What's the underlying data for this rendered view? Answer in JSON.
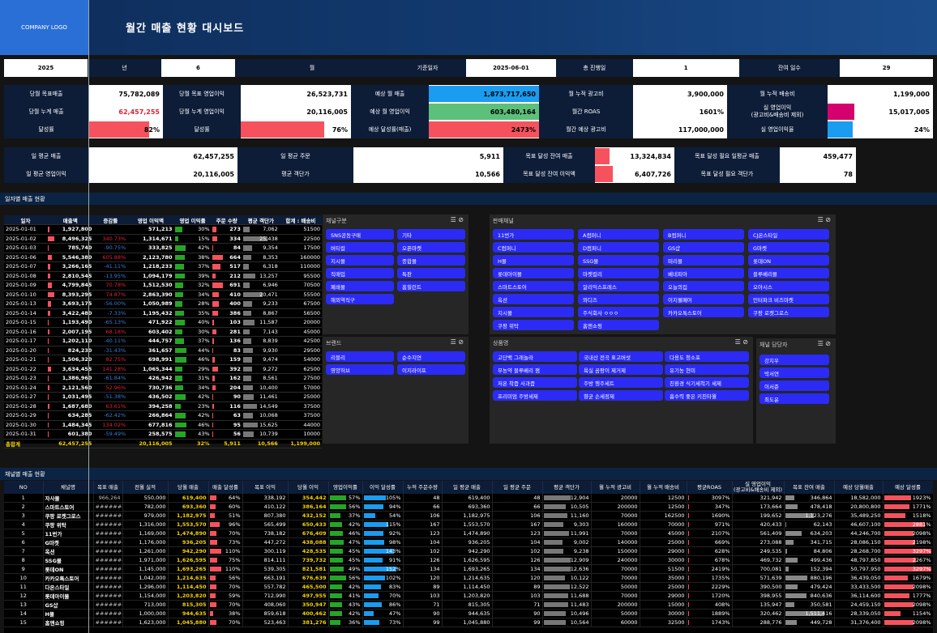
{
  "header": {
    "logo": "COMPANY LOGO",
    "title": "월간 매출 현황 대시보드"
  },
  "filters": {
    "year": "2025",
    "year_label": "년",
    "month": "6",
    "month_label": "월",
    "base_label": "기준일자",
    "base_date": "2025-06-01",
    "elapsed_label": "총 진행일",
    "elapsed": "1",
    "remain_label": "잔여 일수",
    "remain": "29"
  },
  "kpi": [
    {
      "label": "당월 목표매출",
      "value": "75,782,089"
    },
    {
      "label": "당월 목표 영업이익",
      "value": "26,523,731"
    },
    {
      "label": "예상 월 매출",
      "value": "1,873,717,650",
      "bar": 1.0,
      "color": "#1a9cf0"
    },
    {
      "label": "월 누적 광고비",
      "value": "3,900,000"
    },
    {
      "label": "월 누적 배송비",
      "value": "1,199,000"
    },
    {
      "label": "당월 누계 매출",
      "value": "62,457,255",
      "red": true
    },
    {
      "label": "당월 누계 영업이익",
      "value": "20,116,005"
    },
    {
      "label": "예상 월 영업이익",
      "value": "603,480,164",
      "bar": 1.0,
      "color": "#5cc07a"
    },
    {
      "label": "월간 ROAS",
      "value": "1601%"
    },
    {
      "label": "실 영업이익\n(광고비&배송비 제외)",
      "value": "15,017,005",
      "bar": 0.25,
      "color": "#d4006e"
    },
    {
      "label": "달성률",
      "value": "82%",
      "bar": 0.82,
      "color": "#f6525e"
    },
    {
      "label": "달성률",
      "value": "76%",
      "bar": 0.76,
      "color": "#f6525e"
    },
    {
      "label": "예상 달성률(매출)",
      "value": "2473%",
      "bar": 1.0,
      "color": "#f6525e"
    },
    {
      "label": "월간 예상 광고비",
      "value": "117,000,000"
    },
    {
      "label": "실 영업이익율",
      "value": "24%",
      "bar": 0.24,
      "color": "#1a9cf0"
    }
  ],
  "kpi2": [
    {
      "label": "일 평균 매출",
      "value": "62,457,255"
    },
    {
      "label": "일 평균 주문",
      "value": "5,911"
    },
    {
      "label": "목표 달성 잔여 매출",
      "value": "13,324,834",
      "bar": 0.18,
      "color": "#f6525e"
    },
    {
      "label": "목표 달성 필요 일평균 매출",
      "value": "459,477"
    },
    {
      "label": "일 평균 영업이익",
      "value": "20,116,005"
    },
    {
      "label": "평균 객단가",
      "value": "10,566"
    },
    {
      "label": "목표 달성 잔여 이익액",
      "value": "6,407,726",
      "bar": 0.22,
      "color": "#f6525e"
    },
    {
      "label": "목표 달성 필요 객단가",
      "value": "78"
    }
  ],
  "daily_section": "일자별 매출 현황",
  "daily_headers": [
    "일자",
    "매출액",
    "증감률",
    "영업 이익액",
    "영업 이익률",
    "주문 수량",
    "평균 객단가",
    "합계 : 배송비"
  ],
  "daily": [
    [
      "2025-01-01",
      "1,927,800",
      "",
      "571,213",
      "30%",
      "273",
      "7,062",
      "51500"
    ],
    [
      "2025-01-02",
      "8,496,325",
      "340.73%",
      "1,314,671",
      "15%",
      "334",
      "25,438",
      "22500"
    ],
    [
      "2025-01-03",
      "785,740",
      "-90.75%",
      "333,825",
      "42%",
      "84",
      "9,354",
      "17500"
    ],
    [
      "2025-01-06",
      "5,546,380",
      "605.88%",
      "2,123,780",
      "38%",
      "664",
      "8,353",
      "160000"
    ],
    [
      "2025-01-07",
      "3,266,165",
      "-41.11%",
      "1,218,233",
      "37%",
      "517",
      "6,318",
      "110000"
    ],
    [
      "2025-01-08",
      "2,810,545",
      "-13.95%",
      "1,094,179",
      "39%",
      "212",
      "13,257",
      "95500"
    ],
    [
      "2025-01-09",
      "4,799,845",
      "70.78%",
      "1,512,530",
      "32%",
      "691",
      "6,946",
      "70500"
    ],
    [
      "2025-01-10",
      "8,393,295",
      "74.87%",
      "2,863,390",
      "34%",
      "410",
      "20,471",
      "55500"
    ],
    [
      "2025-01-13",
      "3,693,175",
      "-56.00%",
      "1,050,989",
      "28%",
      "400",
      "9,233",
      "67500"
    ],
    [
      "2025-01-14",
      "3,422,480",
      "-7.33%",
      "1,195,432",
      "35%",
      "386",
      "8,867",
      "56500"
    ],
    [
      "2025-01-15",
      "1,193,490",
      "-65.13%",
      "471,922",
      "40%",
      "103",
      "11,587",
      "20000"
    ],
    [
      "2025-01-16",
      "2,007,195",
      "68.18%",
      "603,402",
      "30%",
      "281",
      "7,143",
      "45000"
    ],
    [
      "2025-01-17",
      "1,202,110",
      "-40.11%",
      "444,757",
      "37%",
      "136",
      "8,839",
      "42500"
    ],
    [
      "2025-01-20",
      "824,230",
      "-31.43%",
      "361,657",
      "44%",
      "83",
      "9,930",
      "29500"
    ],
    [
      "2025-01-21",
      "1,506,320",
      "82.75%",
      "698,991",
      "46%",
      "159",
      "9,474",
      "54000"
    ],
    [
      "2025-01-22",
      "3,634,455",
      "141.28%",
      "1,065,344",
      "29%",
      "392",
      "9,272",
      "62500"
    ],
    [
      "2025-01-23",
      "1,386,960",
      "-61.84%",
      "426,942",
      "31%",
      "162",
      "8,561",
      "27500"
    ],
    [
      "2025-01-24",
      "2,121,560",
      "52.96%",
      "730,736",
      "34%",
      "204",
      "10,400",
      "57000"
    ],
    [
      "2025-01-27",
      "1,031,495",
      "-51.38%",
      "436,502",
      "42%",
      "90",
      "11,461",
      "25000"
    ],
    [
      "2025-01-28",
      "1,687,680",
      "63.61%",
      "394,258",
      "23%",
      "116",
      "14,549",
      "37500"
    ],
    [
      "2025-01-29",
      "634,285",
      "-62.42%",
      "266,864",
      "42%",
      "63",
      "10,068",
      "37500"
    ],
    [
      "2025-01-30",
      "1,484,345",
      "134.02%",
      "677,816",
      "46%",
      "95",
      "15,625",
      "44000"
    ],
    [
      "2025-01-31",
      "601,380",
      "-59.49%",
      "258,575",
      "43%",
      "56",
      "10,739",
      "10000"
    ]
  ],
  "daily_total": [
    "총합계",
    "62,457,255",
    "",
    "20,116,005",
    "32%",
    "5,911",
    "10,566",
    "1,199,000"
  ],
  "panels": {
    "channel_type": {
      "title": "채널구분",
      "items": [
        "SNS공동구매",
        "기타",
        "버티컬",
        "오픈마켓",
        "지시몰",
        "종합몰",
        "직매입",
        "특판",
        "폐쇄몰",
        "홈힐런트",
        "해외역직구"
      ]
    },
    "sales_channel": {
      "title": "판매채널",
      "items": [
        "11번가",
        "A컴퍼니",
        "B컴퍼니",
        "CJ온스타일",
        "C컴퍼니",
        "D컴퍼니",
        "GS샵",
        "G마켓",
        "H몰",
        "SSG몰",
        "떠리몰",
        "롯데ON",
        "롯데아이몰",
        "마켓컬리",
        "베네피아",
        "블루베리몰",
        "스마트스토어",
        "알리익스프레스",
        "오늘의집",
        "오아시스",
        "옥션",
        "와디즈",
        "이지웰페어",
        "인터파크 비즈마켓",
        "지시몰",
        "주식회사 ㅇㅇㅇ",
        "카카오톡스토어",
        "쿠팡 로켓그로스",
        "쿠팡 위탁",
        "홈앤쇼핑"
      ]
    },
    "brand": {
      "title": "브랜드",
      "items": [
        "리블리",
        "순수지연",
        "영양허브",
        "이지라이프"
      ]
    },
    "product": {
      "title": "상품명",
      "items": [
        "고단백 그래놀라",
        "국내산 전곡 표고버섯",
        "다용도 청소포",
        "무농약 블루베리 잼",
        "욕실 곰팡이 제거제",
        "유기농 현미",
        "저온 착즙 사과즙",
        "주방 행주세트",
        "친환경 식기세척기 세제",
        "프리미엄 주방세제",
        "향균 손세정제",
        "흡수력 좋은 키친타월"
      ]
    },
    "manager": {
      "title": "채널 담당자",
      "items": [
        "강지우",
        "박서연",
        "이서준",
        "최도윤"
      ]
    }
  },
  "channel_section": "채널별 매출 현황",
  "channel_headers": [
    "NO",
    "채널명",
    "목표 매출",
    "전월 실적",
    "당월 매출",
    "매출 달성률",
    "목표 이익",
    "당월 이익",
    "영업이익률",
    "이익 달성률",
    "누적 주문수량",
    "일 평균 매출",
    "일 평균 주문",
    "평균 객단가",
    "월 누적 광고비",
    "월 누적 배송비",
    "평균ROAS",
    "실 영업이익\n(광고비&배송비 제외)",
    "목표 잔여 매출",
    "예상 당월매출",
    "예상 달성률"
  ],
  "channels": [
    [
      "1",
      "자사몰",
      "966,264",
      "550,000",
      "619,400",
      "64%",
      "338,192",
      "354,442",
      "57%",
      "105%",
      "48",
      "619,400",
      "48",
      "12,904",
      "20000",
      "12500",
      "3097%",
      "321,942",
      "346,864",
      "18,582,000",
      "1923%"
    ],
    [
      "2",
      "스마트스토어",
      "#######",
      "782,000",
      "693,360",
      "60%",
      "410,122",
      "386,164",
      "56%",
      "94%",
      "66",
      "693,360",
      "66",
      "10,505",
      "200000",
      "12500",
      "347%",
      "173,664",
      "478,418",
      "20,800,800",
      "1771%"
    ],
    [
      "3",
      "쿠팡 로켓그로스",
      "#######",
      "979,000",
      "1,182,975",
      "51%",
      "807,380",
      "432,152",
      "37%",
      "54%",
      "106",
      "1,182,975",
      "106",
      "11,160",
      "70000",
      "162500",
      "1690%",
      "199,652",
      "1,123,276",
      "35,489,250",
      "1518%"
    ],
    [
      "4",
      "쿠팡 위탁",
      "#######",
      "1,316,000",
      "1,553,570",
      "96%",
      "565,499",
      "650,433",
      "42%",
      "115%",
      "167",
      "1,553,570",
      "167",
      "9,303",
      "160000",
      "70000",
      "971%",
      "420,433",
      "62,143",
      "46,607,100",
      "2881%"
    ],
    [
      "5",
      "11번가",
      "#######",
      "1,169,000",
      "1,474,890",
      "70%",
      "738,182",
      "676,409",
      "46%",
      "92%",
      "123",
      "1,474,890",
      "123",
      "11,991",
      "70000",
      "45000",
      "2107%",
      "561,409",
      "634,203",
      "44,246,700",
      "2098%"
    ],
    [
      "6",
      "G마켓",
      "#######",
      "1,176,000",
      "936,205",
      "73%",
      "447,272",
      "438,088",
      "47%",
      "98%",
      "104",
      "936,205",
      "104",
      "9,002",
      "140000",
      "25000",
      "669%",
      "273,088",
      "341,715",
      "28,086,150",
      "2198%"
    ],
    [
      "7",
      "옥션",
      "#######",
      "1,261,000",
      "942,290",
      "110%",
      "300,119",
      "428,535",
      "45%",
      "143%",
      "102",
      "942,290",
      "102",
      "9,238",
      "150000",
      "29000",
      "628%",
      "249,535",
      "84,806",
      "28,268,700",
      "3297%"
    ],
    [
      "8",
      "SSG몰",
      "#######",
      "1,971,000",
      "1,626,595",
      "75%",
      "814,111",
      "739,732",
      "45%",
      "91%",
      "126",
      "1,626,595",
      "126",
      "12,909",
      "240000",
      "30000",
      "678%",
      "469,732",
      "499,436",
      "48,797,850",
      "2267%"
    ],
    [
      "9",
      "롯데ON",
      "#######",
      "1,145,000",
      "1,693,265",
      "110%",
      "539,305",
      "821,581",
      "49%",
      "152%",
      "134",
      "1,693,265",
      "134",
      "12,636",
      "70000",
      "51500",
      "2419%",
      "700,081",
      "152,394",
      "50,797,950",
      "3297%"
    ],
    [
      "10",
      "카카오톡스토어",
      "#######",
      "1,042,000",
      "1,214,635",
      "56%",
      "663,191",
      "676,639",
      "56%",
      "102%",
      "120",
      "1,214,635",
      "120",
      "10,122",
      "70000",
      "35000",
      "1735%",
      "571,639",
      "880,196",
      "36,439,050",
      "1679%"
    ],
    [
      "11",
      "다온스타일",
      "#######",
      "1,296,000",
      "1,114,450",
      "70%",
      "557,782",
      "465,500",
      "42%",
      "83%",
      "89",
      "1,114,450",
      "89",
      "12,522",
      "50000",
      "25000",
      "2229%",
      "390,500",
      "479,424",
      "33,433,500",
      "2098%"
    ],
    [
      "12",
      "롯데아이몰",
      "#######",
      "1,154,000",
      "1,203,820",
      "59%",
      "712,990",
      "497,955",
      "41%",
      "70%",
      "103",
      "1,203,820",
      "103",
      "11,688",
      "70000",
      "29000",
      "1720%",
      "398,955",
      "840,636",
      "36,114,600",
      "1777%"
    ],
    [
      "13",
      "GS샵",
      "#######",
      "713,000",
      "815,305",
      "70%",
      "408,060",
      "350,947",
      "43%",
      "86%",
      "71",
      "815,305",
      "71",
      "11,483",
      "200000",
      "15000",
      "408%",
      "135,947",
      "350,581",
      "24,459,150",
      "2098%"
    ],
    [
      "14",
      "H몰",
      "#######",
      "1,000,000",
      "944,635",
      "38%",
      "859,618",
      "400,462",
      "42%",
      "47%",
      "90",
      "944,635",
      "90",
      "10,496",
      "50000",
      "30000",
      "1889%",
      "320,462",
      "1,511,416",
      "28,339,050",
      "1154%"
    ],
    [
      "15",
      "홈앤쇼핑",
      "#######",
      "1,623,000",
      "1,045,880",
      "70%",
      "523,463",
      "381,276",
      "36%",
      "73%",
      "99",
      "1,045,880",
      "99",
      "10,564",
      "60000",
      "32500",
      "1743%",
      "288,776",
      "449,728",
      "31,376,400",
      "2098%"
    ]
  ],
  "colors": {
    "red_bar": "#f6525e",
    "green_bar": "#26a626",
    "blue_bar": "#1a9cf0",
    "gray_bar": "#777777",
    "chip": "#2b2bf5"
  }
}
